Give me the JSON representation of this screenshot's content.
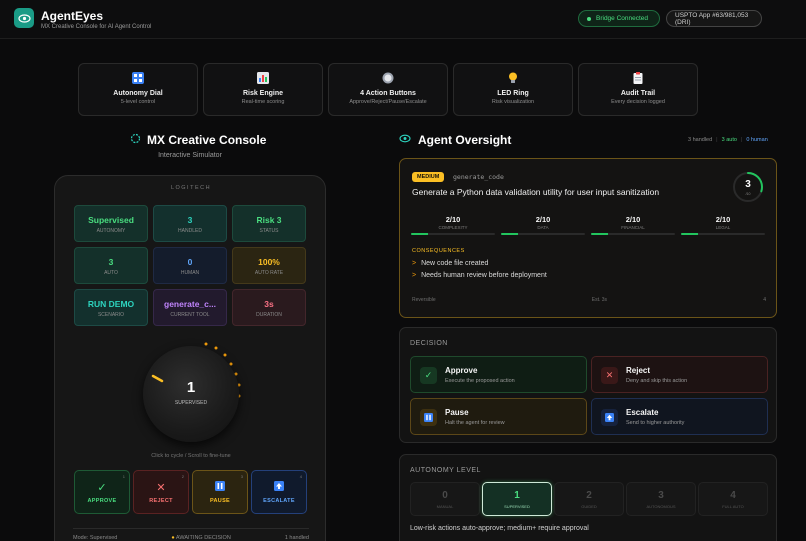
{
  "header": {
    "title": "AgentEyes",
    "subtitle": "MX Creative Console for AI Agent Control",
    "bridge_status": "Bridge Connected",
    "patent": "USPTO App #63/981,053 (DRI)"
  },
  "features": [
    {
      "icon": "grid-icon",
      "title": "Autonomy Dial",
      "subtitle": "5-level control"
    },
    {
      "icon": "chart-icon",
      "title": "Risk Engine",
      "subtitle": "Real-time scoring"
    },
    {
      "icon": "buttons-icon",
      "title": "4 Action Buttons",
      "subtitle": "Approve/Reject/Pause/Escalate"
    },
    {
      "icon": "lightbulb-icon",
      "title": "LED Ring",
      "subtitle": "Risk visualization"
    },
    {
      "icon": "clipboard-icon",
      "title": "Audit Trail",
      "subtitle": "Every decision logged"
    }
  ],
  "console": {
    "title": "MX Creative Console",
    "subtitle": "Interactive Simulator",
    "brand": "LOGITECH",
    "tiles": [
      {
        "value": "Supervised",
        "label": "Autonomy"
      },
      {
        "value": "3",
        "label": "Handled"
      },
      {
        "value": "Risk 3",
        "label": "Status"
      },
      {
        "value": "3",
        "label": "Auto"
      },
      {
        "value": "0",
        "label": "Human"
      },
      {
        "value": "100%",
        "label": "Auto Rate"
      },
      {
        "value": "RUN DEMO",
        "label": "Scenario"
      },
      {
        "value": "generate_c...",
        "label": "Current Tool"
      },
      {
        "value": "3s",
        "label": "Duration"
      }
    ],
    "dial_value": "1",
    "dial_label": "SUPERVISED",
    "dial_hint": "Click to cycle / Scroll to fine-tune",
    "buttons": [
      {
        "label": "APPROVE",
        "num": "1",
        "icon": "check-icon"
      },
      {
        "label": "REJECT",
        "num": "2",
        "icon": "x-icon"
      },
      {
        "label": "PAUSE",
        "num": "3",
        "icon": "pause-icon"
      },
      {
        "label": "ESCALATE",
        "num": "4",
        "icon": "arrow-up-icon"
      }
    ],
    "footer": {
      "mode": "Mode: Supervised",
      "status": "AWAITING DECISION",
      "handled": "1 handled"
    }
  },
  "oversight": {
    "title": "Agent Oversight",
    "stats": {
      "handled": "3 handled",
      "auto": "3 auto",
      "human": "0 human"
    },
    "card": {
      "risk_badge": "MEDIUM",
      "tool": "generate_code",
      "task": "Generate a Python data validation utility for user input sanitization",
      "risk_score": "3",
      "risk_score_fraction": 0.3,
      "risk_sub": "/10",
      "metrics": [
        {
          "value": "2/10",
          "label": "Complexity",
          "fraction": 0.2
        },
        {
          "value": "2/10",
          "label": "Data",
          "fraction": 0.2
        },
        {
          "value": "2/10",
          "label": "Financial",
          "fraction": 0.2
        },
        {
          "value": "2/10",
          "label": "Legal",
          "fraction": 0.2
        }
      ],
      "consequences_title": "CONSEQUENCES",
      "consequences": [
        "New code file created",
        "Needs human review before deployment"
      ],
      "footer_left": "Reversible",
      "footer_mid": "Est. 3s",
      "footer_right": "4"
    }
  },
  "decision": {
    "title": "DECISION",
    "buttons": [
      {
        "title": "Approve",
        "desc": "Execute the proposed action"
      },
      {
        "title": "Reject",
        "desc": "Deny and skip this action"
      },
      {
        "title": "Pause",
        "desc": "Halt the agent for review"
      },
      {
        "title": "Escalate",
        "desc": "Send to higher authority"
      }
    ]
  },
  "autonomy": {
    "title": "AUTONOMY LEVEL",
    "levels": [
      {
        "num": "0",
        "label": "Manual"
      },
      {
        "num": "1",
        "label": "Supervised"
      },
      {
        "num": "2",
        "label": "Guided"
      },
      {
        "num": "3",
        "label": "Autonomous"
      },
      {
        "num": "4",
        "label": "Full Auto"
      }
    ],
    "active_level": 1,
    "description": "Low-risk actions auto-approve; medium+ require approval"
  },
  "colors": {
    "accent": "#2dd4bf",
    "approve": "#4ade80",
    "reject": "#f87171",
    "pause": "#fbbf24",
    "escalate": "#60a5fa"
  }
}
